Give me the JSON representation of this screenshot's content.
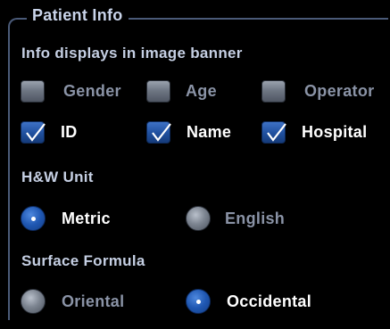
{
  "group": {
    "title": "Patient Info"
  },
  "banner": {
    "heading": "Info displays in image banner",
    "options": [
      {
        "label": "Gender",
        "checked": false
      },
      {
        "label": "Age",
        "checked": false
      },
      {
        "label": "Operator",
        "checked": false
      },
      {
        "label": "ID",
        "checked": true
      },
      {
        "label": "Name",
        "checked": true
      },
      {
        "label": "Hospital",
        "checked": true
      }
    ]
  },
  "hw_unit": {
    "heading": "H&W Unit",
    "options": [
      {
        "label": "Metric",
        "selected": true
      },
      {
        "label": "English",
        "selected": false
      }
    ]
  },
  "surface_formula": {
    "heading": "Surface Formula",
    "options": [
      {
        "label": "Oriental",
        "selected": false
      },
      {
        "label": "Occidental",
        "selected": true
      }
    ]
  },
  "colors": {
    "background": "#000000",
    "frame": "#4a5a78",
    "accent_blue": "#1f57b2",
    "unchecked_gray": "#6f7784"
  }
}
